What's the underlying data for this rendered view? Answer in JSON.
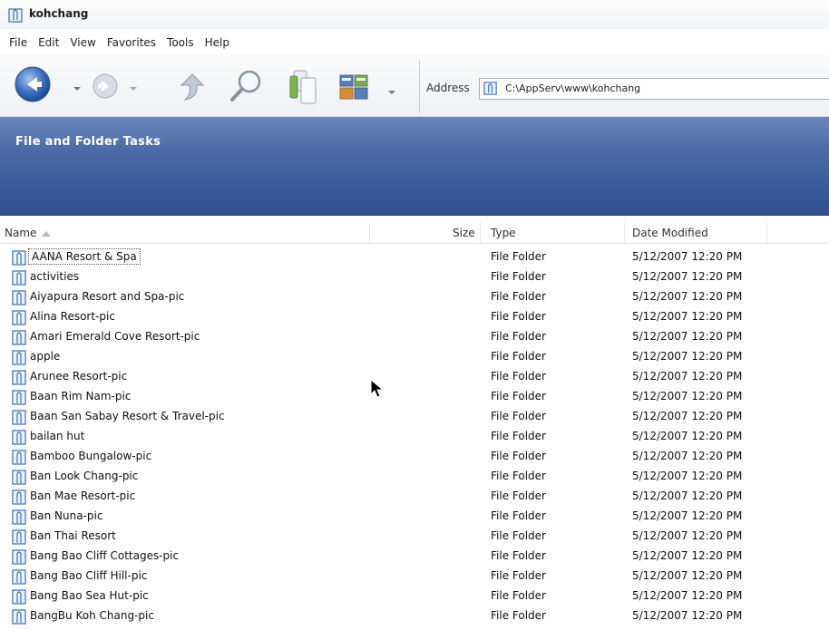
{
  "window": {
    "title": "kohchang"
  },
  "menu": [
    "File",
    "Edit",
    "View",
    "Favorites",
    "Tools",
    "Help"
  ],
  "toolbar": {
    "back_icon": "back-arrow-icon",
    "forward_icon": "forward-arrow-icon",
    "up_icon": "folder-up-icon",
    "search_icon": "search-icon",
    "folders_icon": "folders-icon",
    "views_icon": "views-icon"
  },
  "address": {
    "label": "Address",
    "path": "C:\\AppServ\\www\\kohchang"
  },
  "task_pane": {
    "title": "File and Folder Tasks"
  },
  "columns": {
    "name": "Name",
    "size": "Size",
    "type": "Type",
    "date": "Date Modified"
  },
  "files": [
    {
      "name": "AANA Resort & Spa",
      "type": "File Folder",
      "date": "5/12/2007 12:20 PM"
    },
    {
      "name": "activities",
      "type": "File Folder",
      "date": "5/12/2007 12:20 PM"
    },
    {
      "name": "Aiyapura Resort and Spa-pic",
      "type": "File Folder",
      "date": "5/12/2007 12:20 PM"
    },
    {
      "name": "Alina Resort-pic",
      "type": "File Folder",
      "date": "5/12/2007 12:20 PM"
    },
    {
      "name": "Amari Emerald Cove Resort-pic",
      "type": "File Folder",
      "date": "5/12/2007 12:20 PM"
    },
    {
      "name": "apple",
      "type": "File Folder",
      "date": "5/12/2007 12:20 PM"
    },
    {
      "name": "Arunee Resort-pic",
      "type": "File Folder",
      "date": "5/12/2007 12:20 PM"
    },
    {
      "name": "Baan Rim Nam-pic",
      "type": "File Folder",
      "date": "5/12/2007 12:20 PM"
    },
    {
      "name": "Baan San Sabay Resort & Travel-pic",
      "type": "File Folder",
      "date": "5/12/2007 12:20 PM"
    },
    {
      "name": "bailan hut",
      "type": "File Folder",
      "date": "5/12/2007 12:20 PM"
    },
    {
      "name": "Bamboo Bungalow-pic",
      "type": "File Folder",
      "date": "5/12/2007 12:20 PM"
    },
    {
      "name": "Ban Look Chang-pic",
      "type": "File Folder",
      "date": "5/12/2007 12:20 PM"
    },
    {
      "name": "Ban Mae Resort-pic",
      "type": "File Folder",
      "date": "5/12/2007 12:20 PM"
    },
    {
      "name": "Ban Nuna-pic",
      "type": "File Folder",
      "date": "5/12/2007 12:20 PM"
    },
    {
      "name": "Ban Thai Resort",
      "type": "File Folder",
      "date": "5/12/2007 12:20 PM"
    },
    {
      "name": "Bang Bao Cliff Cottages-pic",
      "type": "File Folder",
      "date": "5/12/2007 12:20 PM"
    },
    {
      "name": "Bang Bao Cliff Hill-pic",
      "type": "File Folder",
      "date": "5/12/2007 12:20 PM"
    },
    {
      "name": "Bang Bao Sea Hut-pic",
      "type": "File Folder",
      "date": "5/12/2007 12:20 PM"
    },
    {
      "name": "BangBu Koh Chang-pic",
      "type": "File Folder",
      "date": "5/12/2007 12:20 PM"
    }
  ]
}
